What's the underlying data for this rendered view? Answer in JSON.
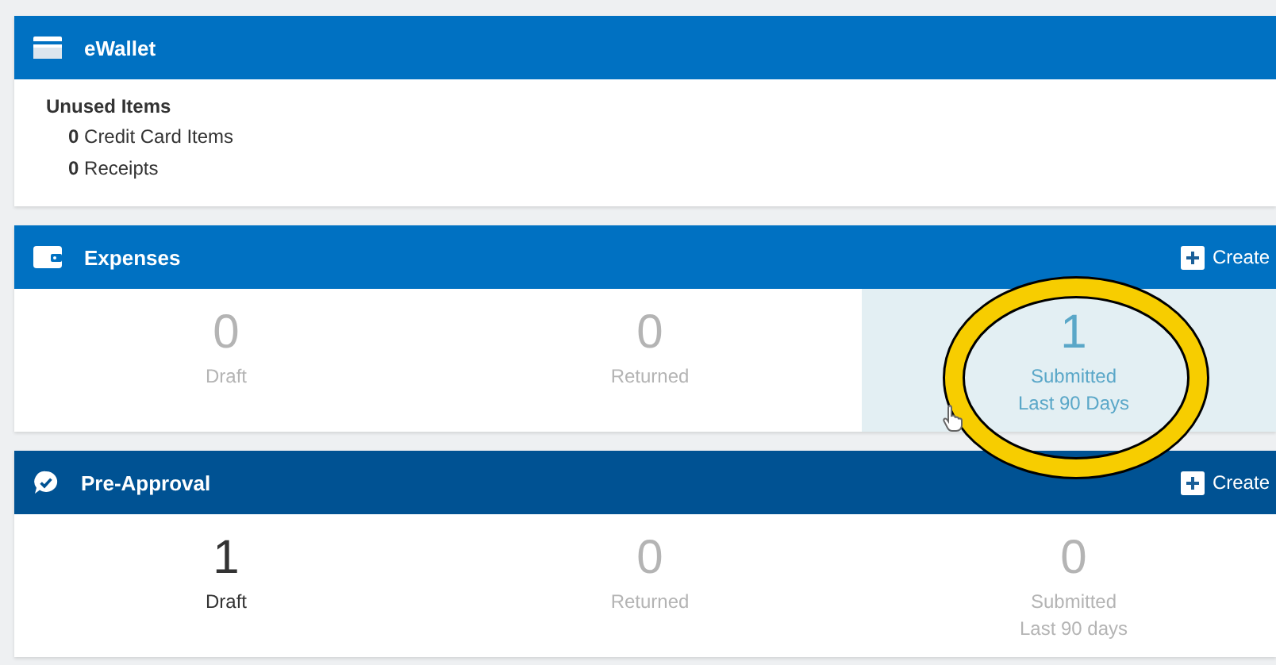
{
  "wallet": {
    "title": "eWallet",
    "heading": "Unused Items",
    "items": [
      {
        "count": "0",
        "label": "Credit Card Items"
      },
      {
        "count": "0",
        "label": "Receipts"
      }
    ]
  },
  "sections": [
    {
      "kind": "expenses",
      "title": "Expenses",
      "action": "Create",
      "tiles": [
        {
          "count": "0",
          "label": "Draft",
          "muted": true,
          "selected": false
        },
        {
          "count": "0",
          "label": "Returned",
          "muted": true,
          "selected": false
        },
        {
          "count": "1",
          "label": "Submitted",
          "sublabel": "Last 90 Days",
          "muted": false,
          "selected": true
        }
      ]
    },
    {
      "kind": "pre-approval",
      "title": "Pre-Approval",
      "action": "Create",
      "tiles": [
        {
          "count": "1",
          "label": "Draft",
          "muted": false,
          "selected": false
        },
        {
          "count": "0",
          "label": "Returned",
          "muted": true,
          "selected": false
        },
        {
          "count": "0",
          "label": "Submitted",
          "sublabel": "Last 90 days",
          "muted": true,
          "selected": false
        }
      ]
    }
  ]
}
